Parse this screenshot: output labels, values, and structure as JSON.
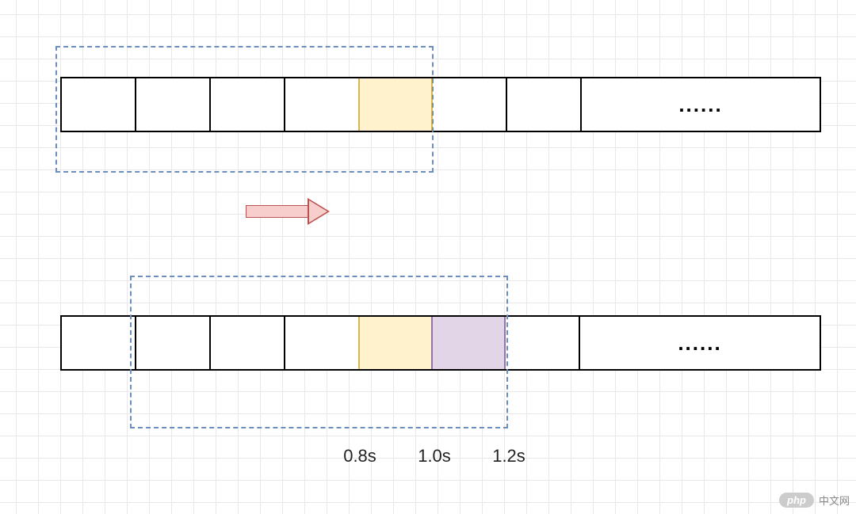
{
  "diagram": {
    "ellipsis": "......",
    "labels": {
      "t1": "0.8s",
      "t2": "1.0s",
      "t3": "1.2s"
    },
    "timeline_top": {
      "cells": [
        {
          "type": "white"
        },
        {
          "type": "white"
        },
        {
          "type": "white"
        },
        {
          "type": "white"
        },
        {
          "type": "yellow"
        },
        {
          "type": "white"
        },
        {
          "type": "white"
        },
        {
          "type": "wide",
          "content": "......"
        }
      ],
      "window_start_index": 0,
      "window_end_index": 5
    },
    "timeline_bottom": {
      "cells": [
        {
          "type": "white"
        },
        {
          "type": "white"
        },
        {
          "type": "white"
        },
        {
          "type": "white"
        },
        {
          "type": "yellow"
        },
        {
          "type": "purple"
        },
        {
          "type": "white"
        },
        {
          "type": "wide",
          "content": "......"
        }
      ],
      "window_start_index": 1,
      "window_end_index": 6
    }
  },
  "watermark": {
    "badge": "php",
    "text": "中文网"
  }
}
